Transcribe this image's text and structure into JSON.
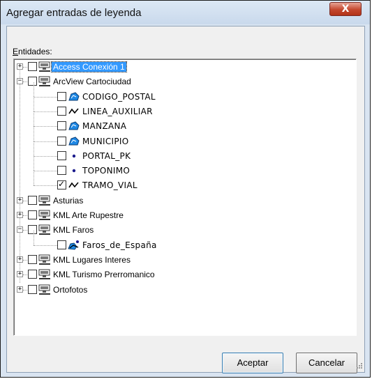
{
  "dialog": {
    "title": "Agregar entradas de leyenda",
    "close_label": "X",
    "label_first_letter": "E",
    "label_rest": "ntidades:"
  },
  "tree": [
    {
      "label": "Access Conexión 1",
      "level": 0,
      "expander": "+",
      "checked": false,
      "icon": "database-connection-icon",
      "selected": true
    },
    {
      "label": "ArcView Cartociudad",
      "level": 0,
      "expander": "-",
      "checked": false,
      "icon": "database-connection-icon"
    },
    {
      "label": "CODIGO_POSTAL",
      "level": 1,
      "checked": false,
      "icon": "polygon-layer-icon"
    },
    {
      "label": "LINEA_AUXILIAR",
      "level": 1,
      "checked": false,
      "icon": "line-layer-icon"
    },
    {
      "label": "MANZANA",
      "level": 1,
      "checked": false,
      "icon": "polygon-layer-icon"
    },
    {
      "label": "MUNICIPIO",
      "level": 1,
      "checked": false,
      "icon": "polygon-layer-icon"
    },
    {
      "label": "PORTAL_PK",
      "level": 1,
      "checked": false,
      "icon": "point-layer-icon"
    },
    {
      "label": "TOPONIMO",
      "level": 1,
      "checked": false,
      "icon": "point-layer-icon"
    },
    {
      "label": "TRAMO_VIAL",
      "level": 1,
      "checked": true,
      "icon": "line-layer-icon"
    },
    {
      "label": "Asturias",
      "level": 0,
      "expander": "+",
      "checked": false,
      "icon": "database-connection-icon"
    },
    {
      "label": "KML Arte Rupestre",
      "level": 0,
      "expander": "+",
      "checked": false,
      "icon": "database-connection-icon"
    },
    {
      "label": "KML Faros",
      "level": 0,
      "expander": "-",
      "checked": false,
      "icon": "database-connection-icon"
    },
    {
      "label": "Faros_de_España",
      "level": 1,
      "checked": false,
      "icon": "mixed-layer-icon"
    },
    {
      "label": "KML Lugares Interes",
      "level": 0,
      "expander": "+",
      "checked": false,
      "icon": "database-connection-icon"
    },
    {
      "label": "KML Turismo Prerromanico",
      "level": 0,
      "expander": "+",
      "checked": false,
      "icon": "database-connection-icon"
    },
    {
      "label": "Ortofotos",
      "level": 0,
      "expander": "+",
      "checked": false,
      "icon": "database-connection-icon"
    }
  ],
  "buttons": {
    "ok_label": "Aceptar",
    "cancel_label": "Cancelar"
  },
  "colors": {
    "selection": "#3399ff",
    "polygon_icon": "#1e88e5",
    "point_icon": "#1b1b8c"
  }
}
